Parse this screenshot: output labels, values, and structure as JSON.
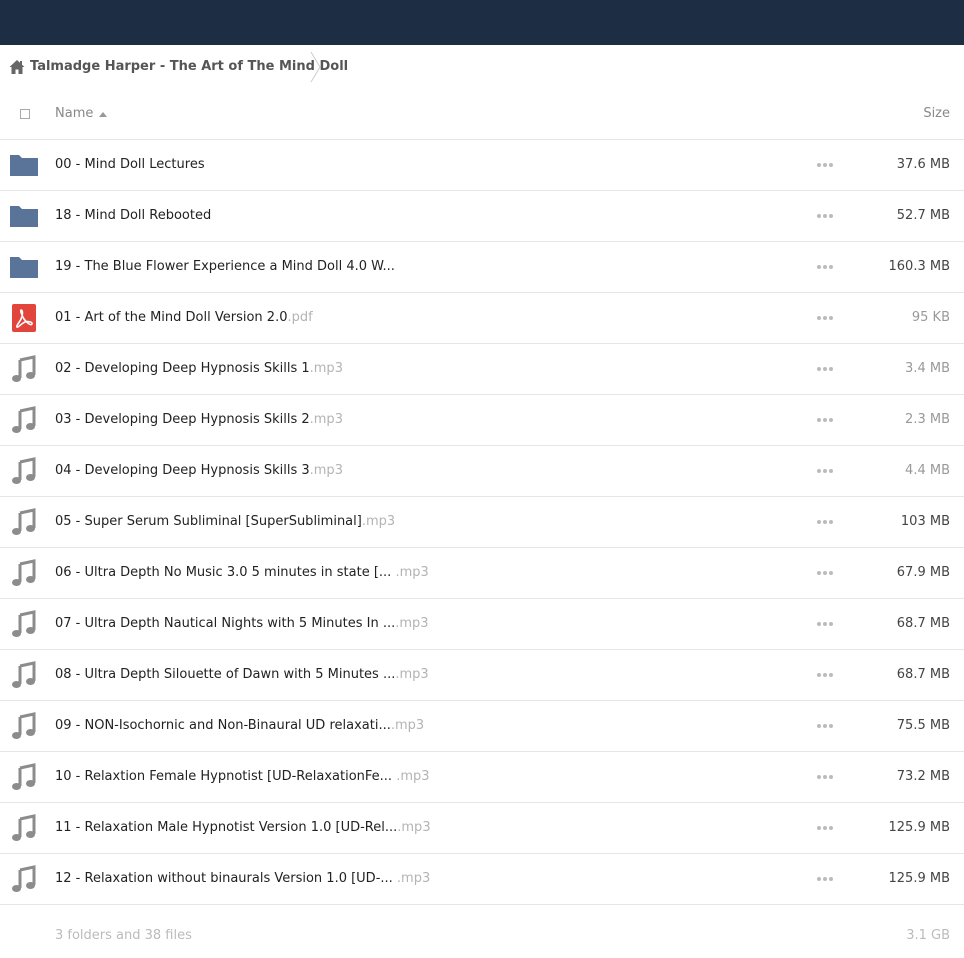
{
  "breadcrumb": {
    "title": "Talmadge Harper - The Art of The Mind Doll"
  },
  "header": {
    "name_label": "Name",
    "size_label": "Size"
  },
  "files": [
    {
      "type": "folder",
      "name": "00 - Mind Doll Lectures",
      "ext": "",
      "size": "37.6 MB"
    },
    {
      "type": "folder",
      "name": "18 - Mind Doll Rebooted",
      "ext": "",
      "size": "52.7 MB"
    },
    {
      "type": "folder",
      "name": "19 - The Blue Flower Experience a Mind Doll 4.0 W...",
      "ext": "",
      "size": "160.3 MB"
    },
    {
      "type": "pdf",
      "name": "01 - Art of the Mind Doll Version 2.0",
      "ext": ".pdf",
      "size": "95 KB"
    },
    {
      "type": "audio",
      "name": "02 - Developing Deep Hypnosis Skills 1",
      "ext": ".mp3",
      "size": "3.4 MB"
    },
    {
      "type": "audio",
      "name": "03 - Developing Deep Hypnosis Skills 2",
      "ext": ".mp3",
      "size": "2.3 MB"
    },
    {
      "type": "audio",
      "name": "04 - Developing Deep Hypnosis Skills 3",
      "ext": ".mp3",
      "size": "4.4 MB"
    },
    {
      "type": "audio",
      "name": "05 - Super Serum Subliminal [SuperSubliminal]",
      "ext": ".mp3",
      "size": "103 MB"
    },
    {
      "type": "audio",
      "name": "06 - Ultra Depth No Music 3.0 5 minutes in state [...  ",
      "ext": ".mp3",
      "size": "67.9 MB"
    },
    {
      "type": "audio",
      "name": "07 - Ultra Depth Nautical Nights with 5 Minutes In ...",
      "ext": ".mp3",
      "size": "68.7 MB"
    },
    {
      "type": "audio",
      "name": "08 - Ultra Depth Silouette of Dawn with 5 Minutes ...",
      "ext": ".mp3",
      "size": "68.7 MB"
    },
    {
      "type": "audio",
      "name": "09 - NON-Isochornic and Non-Binaural UD relaxati...",
      "ext": ".mp3",
      "size": "75.5 MB"
    },
    {
      "type": "audio",
      "name": "10 - Relaxtion Female Hypnotist [UD-RelaxationFe...  ",
      "ext": ".mp3",
      "size": "73.2 MB"
    },
    {
      "type": "audio",
      "name": "11 - Relaxation Male Hypnotist Version 1.0 [UD-Rel...",
      "ext": ".mp3",
      "size": "125.9 MB"
    },
    {
      "type": "audio",
      "name": "12 - Relaxation without binaurals Version 1.0 [UD-...  ",
      "ext": ".mp3",
      "size": "125.9 MB"
    }
  ],
  "summary": {
    "text": "3 folders and 38 files",
    "total": "3.1 GB"
  },
  "colors": {
    "topbar": "#1d2d44",
    "folder": "#5a7399",
    "pdf": "#e2453c",
    "audio": "#8c8c8c"
  }
}
